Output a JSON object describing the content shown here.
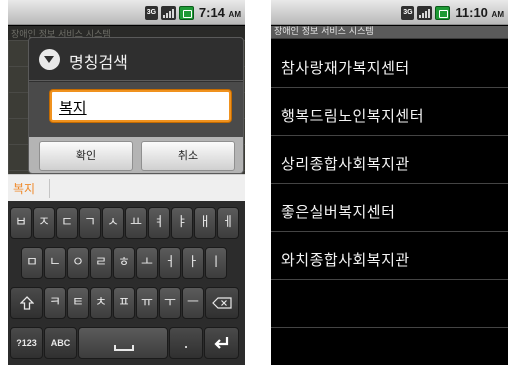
{
  "left_screen": {
    "status": {
      "network": "3G",
      "time": "7:14",
      "ampm": "AM"
    },
    "background_title": "장애인 정보 서비스 시스템",
    "dialog": {
      "title": "명칭검색",
      "input_value": "복지",
      "ok_label": "확인",
      "cancel_label": "취소"
    },
    "suggestion": "복지",
    "keyboard": {
      "row1": [
        "ㅂ",
        "ㅈ",
        "ㄷ",
        "ㄱ",
        "ㅅ",
        "ㅛ",
        "ㅕ",
        "ㅑ",
        "ㅐ",
        "ㅔ"
      ],
      "row2": [
        "ㅁ",
        "ㄴ",
        "ㅇ",
        "ㄹ",
        "ㅎ",
        "ㅗ",
        "ㅓ",
        "ㅏ",
        "ㅣ"
      ],
      "row3": [
        "ㅋ",
        "ㅌ",
        "ㅊ",
        "ㅍ",
        "ㅠ",
        "ㅜ",
        "ㅡ"
      ],
      "mode_numeric": "?123",
      "mode_alpha": "ABC",
      "period": "."
    }
  },
  "right_screen": {
    "status": {
      "network": "3G",
      "time": "11:10",
      "ampm": "AM"
    },
    "title": "장애인 정보 서비스 시스템",
    "results": [
      "참사랑재가복지센터",
      "행복드림노인복지센터",
      "상리종합사회복지관",
      "좋은실버복지센터",
      "와치종합사회복지관"
    ]
  },
  "colors": {
    "accent": "#f0921e",
    "suggestion": "#ef8a2b",
    "battery": "#1e9a35"
  }
}
